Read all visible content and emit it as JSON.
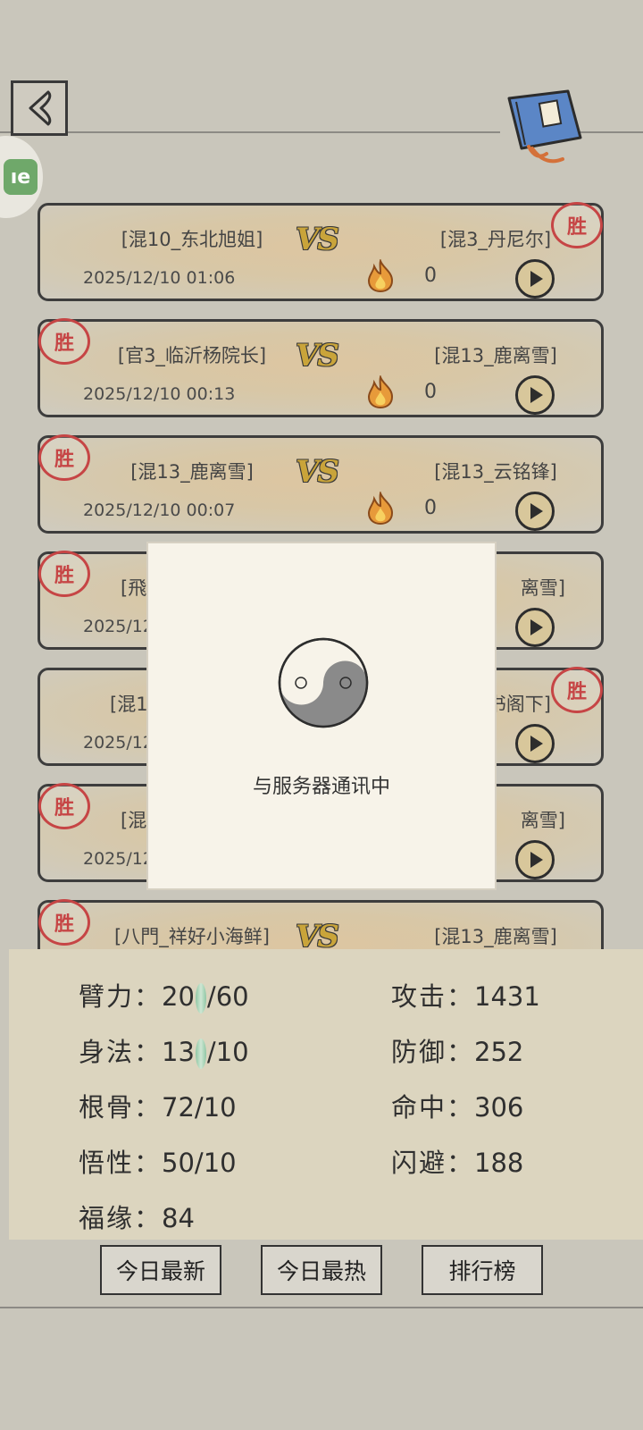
{
  "header": {
    "back_label": "返回",
    "side_badge_text": "ıe"
  },
  "records": [
    {
      "p1": "[混10_东北旭姐]",
      "p2": "[混3_丹尼尔]",
      "vs": "VS",
      "date": "2025/12/10 01:06",
      "heat": "0",
      "winner": "right",
      "seal": "胜"
    },
    {
      "p1": "[官3_临沂杨院长]",
      "p2": "[混13_鹿离雪]",
      "vs": "VS",
      "date": "2025/12/10 00:13",
      "heat": "0",
      "winner": "left",
      "seal": "胜"
    },
    {
      "p1": "[混13_鹿离雪]",
      "p2": "[混13_云铭锋]",
      "vs": "VS",
      "date": "2025/12/10 00:07",
      "heat": "0",
      "winner": "left",
      "seal": "胜"
    },
    {
      "p1": "[飛",
      "p2": "离雪]",
      "vs": "",
      "date": "2025/12",
      "heat": "",
      "winner": "left",
      "seal": "胜"
    },
    {
      "p1": "[混1",
      "p2": "书阁下]",
      "vs": "",
      "date": "2025/12",
      "heat": "",
      "winner": "right",
      "seal": "胜"
    },
    {
      "p1": "[混",
      "p2": "离雪]",
      "vs": "",
      "date": "2025/12",
      "heat": "",
      "winner": "left",
      "seal": "胜"
    },
    {
      "p1": "[八門_祥好小海鲜]",
      "p2": "[混13_鹿离雪]",
      "vs": "VS",
      "date": "",
      "heat": "",
      "winner": "left",
      "seal": "胜"
    }
  ],
  "modal": {
    "message": "与服务器通讯中"
  },
  "stats": {
    "arm": {
      "label": "臂力：",
      "value_a": "20",
      "value_b": "/60"
    },
    "agility": {
      "label": "身法：",
      "value_a": "13",
      "value_b": "/10"
    },
    "bone": {
      "label": "根骨：",
      "value": "72/10"
    },
    "wisdom": {
      "label": "悟性：",
      "value": "50/10"
    },
    "luck": {
      "label": "福缘：",
      "value": "84"
    },
    "attack": {
      "label": "攻击：",
      "value": "1431"
    },
    "defense": {
      "label": "防御：",
      "value": "252"
    },
    "hit": {
      "label": "命中：",
      "value": "306"
    },
    "dodge": {
      "label": "闪避：",
      "value": "188"
    }
  },
  "nav": {
    "today_new": "今日最新",
    "today_hot": "今日最热",
    "ranking": "排行榜"
  },
  "colors": {
    "seal_red": "#c64545",
    "vs_gold": "#c9a43a",
    "book_blue": "#5b86c6"
  }
}
